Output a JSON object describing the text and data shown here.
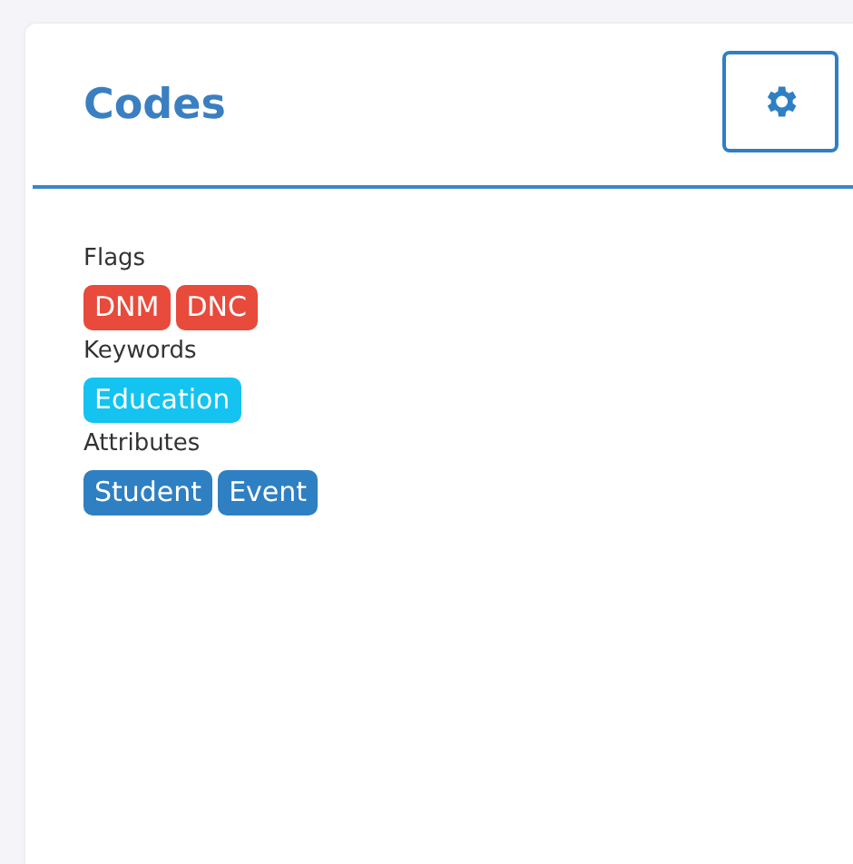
{
  "panel": {
    "title": "Codes"
  },
  "groups": [
    {
      "label": "Flags",
      "tags": [
        {
          "text": "DNM",
          "color": "#e84a3b"
        },
        {
          "text": "DNC",
          "color": "#e84a3b"
        }
      ]
    },
    {
      "label": "Keywords",
      "tags": [
        {
          "text": "Education",
          "color": "#14c3f0"
        }
      ]
    },
    {
      "label": "Attributes",
      "tags": [
        {
          "text": "Student",
          "color": "#2f7fc3"
        },
        {
          "text": "Event",
          "color": "#2f7fc3"
        }
      ]
    }
  ]
}
